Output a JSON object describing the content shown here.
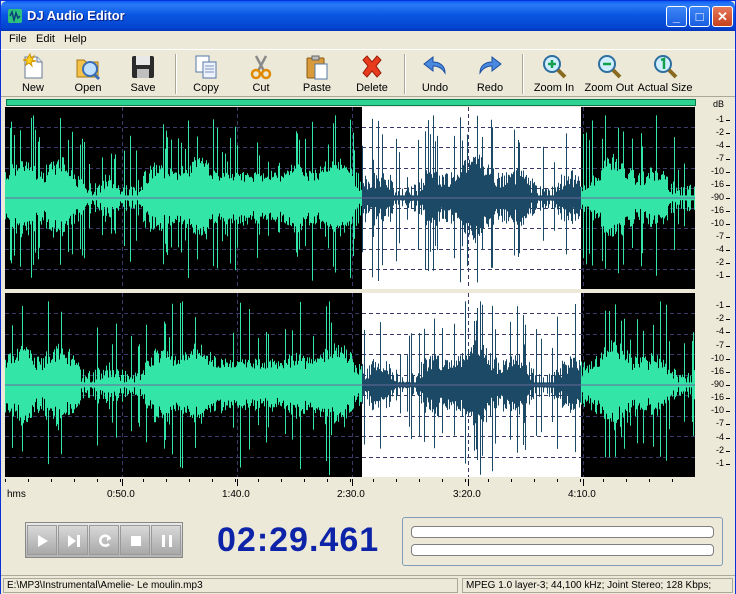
{
  "window": {
    "title": "DJ Audio Editor"
  },
  "title_buttons": {
    "minimize": "_",
    "maximize": "□",
    "close": "✕"
  },
  "menu": [
    "File",
    "Edit",
    "Help"
  ],
  "toolbar": {
    "new": "New",
    "open": "Open",
    "save": "Save",
    "copy": "Copy",
    "cut": "Cut",
    "paste": "Paste",
    "delete": "Delete",
    "undo": "Undo",
    "redo": "Redo",
    "zoom_in": "Zoom In",
    "zoom_out": "Zoom Out",
    "actual_size": "Actual Size"
  },
  "db_scale": {
    "unit": "dB",
    "ticks": [
      "-1",
      "-2",
      "-4",
      "-7",
      "-10",
      "-16",
      "-90",
      "-16",
      "-10",
      "-7",
      "-4",
      "-2",
      "-1"
    ]
  },
  "timeline": {
    "unit": "hms",
    "labels": [
      "0:50.0",
      "1:40.0",
      "2:30.0",
      "3:20.0",
      "4:10.0"
    ]
  },
  "waveform": {
    "duration_seconds": 290,
    "selection_start_seconds": 150,
    "selection_end_seconds": 242,
    "wave_color": "#33e6a8",
    "selected_wave_color": "#1c4a66",
    "selection_bg": "#ffffff"
  },
  "player": {
    "time": "02:29.461",
    "time_color": "#0d23a8"
  },
  "status": {
    "file_path": "E:\\MP3\\Instrumental\\Amelie- Le moulin.mp3",
    "format": "MPEG 1.0 layer-3; 44,100 kHz; Joint Stereo; 128 Kbps;"
  }
}
